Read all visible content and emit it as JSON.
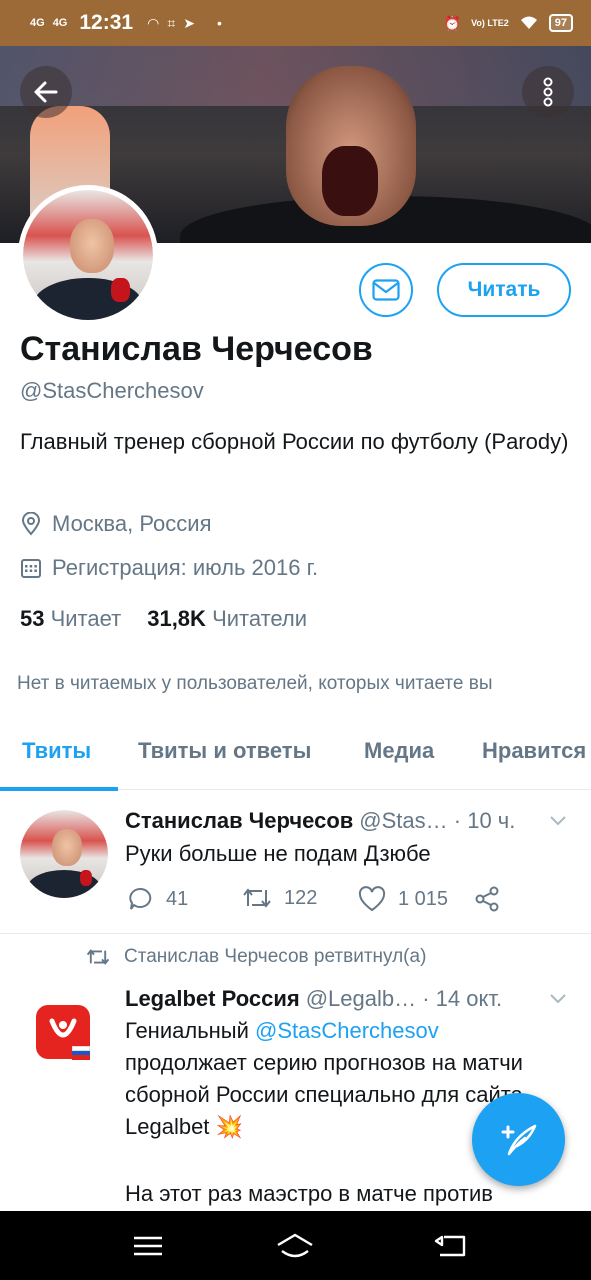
{
  "status_bar": {
    "net1": "4G",
    "net2": "4G",
    "time": "12:31",
    "volte": "Vo) LTE2",
    "battery": "97"
  },
  "profile": {
    "display_name": "Станислав Черчесов",
    "handle": "@StasCherchesov",
    "bio": "Главный тренер сборной России по футболу (Parody)",
    "location": "Москва, Россия",
    "joined": "Регистрация: июль 2016 г.",
    "following_count": "53",
    "following_label": "Читает",
    "followers_count": "31,8K",
    "followers_label": "Читатели",
    "follow_button": "Читать",
    "mutuals_notice": "Нет в читаемых у пользователей, которых читаете вы"
  },
  "tabs": [
    {
      "label": "Твиты",
      "active": true
    },
    {
      "label": "Твиты и ответы",
      "active": false
    },
    {
      "label": "Медиа",
      "active": false
    },
    {
      "label": "Нравится",
      "active": false
    }
  ],
  "tweets": [
    {
      "author": "Станислав Черчесов",
      "handle_time": "@Stas… · 10 ч.",
      "text": "Руки больше не подам Дзюбе",
      "replies": "41",
      "retweets": "122",
      "likes": "1 015"
    },
    {
      "retweeted_by": "Станислав Черчесов ретвитнул(а)",
      "author": "Legalbet Россия",
      "handle_time": "@Legalb… · 14 окт.",
      "text_1": "Гениальный ",
      "mention": "@StasCherchesov",
      "text_2": " продолжает серию прогнозов на матчи сборной России специально для сайта Legalbet 💥",
      "text_3": "На этот раз маэстро в матче против"
    }
  ],
  "colors": {
    "accent": "#1da1f2",
    "status_bar": "#9b6a36",
    "secondary_text": "#657786"
  },
  "icons": [
    "back-arrow-icon",
    "more-vertical-icon",
    "mail-icon",
    "location-pin-icon",
    "calendar-icon",
    "reply-icon",
    "retweet-icon",
    "like-icon",
    "share-icon",
    "compose-icon",
    "menu-icon",
    "home-icon",
    "back-nav-icon"
  ]
}
